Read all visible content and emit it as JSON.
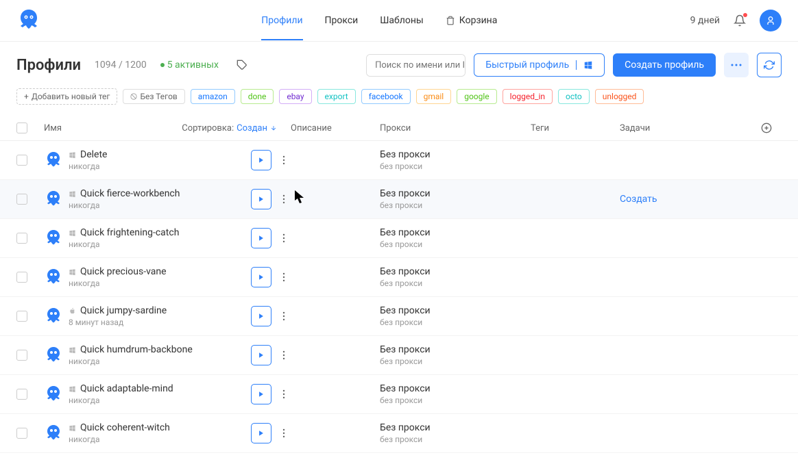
{
  "header": {
    "nav": [
      "Профили",
      "Прокси",
      "Шаблоны",
      "Корзина"
    ],
    "active_index": 0,
    "days": "9 дней"
  },
  "toolbar": {
    "title": "Профили",
    "counter": "1094 / 1200",
    "active": "5 активных",
    "search_placeholder": "Поиск по имени или ID",
    "quick_profile": "Быстрый профиль",
    "create_profile": "Создать профиль"
  },
  "tags_row": {
    "add_tag": "Добавить новый тег",
    "no_tags": "Без Тегов",
    "tags": [
      {
        "label": "amazon",
        "border": "#91caff",
        "color": "#1677ff"
      },
      {
        "label": "done",
        "border": "#b7eb8f",
        "color": "#52c41a"
      },
      {
        "label": "ebay",
        "border": "#d3adf7",
        "color": "#722ed1"
      },
      {
        "label": "export",
        "border": "#87e8de",
        "color": "#13c2c2"
      },
      {
        "label": "facebook",
        "border": "#91caff",
        "color": "#1677ff"
      },
      {
        "label": "gmail",
        "border": "#ffd591",
        "color": "#fa8c16"
      },
      {
        "label": "google",
        "border": "#b7eb8f",
        "color": "#52c41a"
      },
      {
        "label": "logged_in",
        "border": "#ffa39e",
        "color": "#f5222d"
      },
      {
        "label": "octo",
        "border": "#87e8de",
        "color": "#13c2c2"
      },
      {
        "label": "unlogged",
        "border": "#ffbb96",
        "color": "#fa541c"
      }
    ]
  },
  "columns": {
    "name": "Имя",
    "sort_label": "Сортировка:",
    "sort_value": "Создан",
    "desc": "Описание",
    "proxy": "Прокси",
    "tags": "Теги",
    "tasks": "Задачи"
  },
  "proxy_default": {
    "main": "Без прокси",
    "sub": "без прокси"
  },
  "create_task": "Создать",
  "rows": [
    {
      "name": "Delete",
      "time": "никогда",
      "os": "win"
    },
    {
      "name": "Quick fierce-workbench",
      "time": "никогда",
      "os": "win",
      "hover": true,
      "show_create": true
    },
    {
      "name": "Quick frightening-catch",
      "time": "никогда",
      "os": "win"
    },
    {
      "name": "Quick precious-vane",
      "time": "никогда",
      "os": "win"
    },
    {
      "name": "Quick jumpy-sardine",
      "time": "8 минут назад",
      "os": "mac"
    },
    {
      "name": "Quick humdrum-backbone",
      "time": "никогда",
      "os": "win"
    },
    {
      "name": "Quick adaptable-mind",
      "time": "никогда",
      "os": "win"
    },
    {
      "name": "Quick coherent-witch",
      "time": "никогда",
      "os": "win"
    }
  ]
}
